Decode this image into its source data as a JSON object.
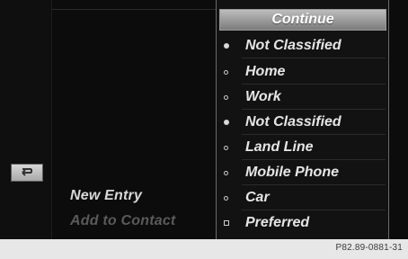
{
  "center": {
    "items": [
      {
        "label": "New Entry",
        "state": "active"
      },
      {
        "label": "Add to Contact",
        "state": "disabled"
      }
    ]
  },
  "panel": {
    "continue_label": "Continue",
    "rows": [
      {
        "label": "Not Classified",
        "marker": "dot-filled"
      },
      {
        "label": "Home",
        "marker": "dot-hollow"
      },
      {
        "label": "Work",
        "marker": "dot-hollow"
      },
      {
        "label": "Not Classified",
        "marker": "dot-filled"
      },
      {
        "label": "Land Line",
        "marker": "dot-hollow"
      },
      {
        "label": "Mobile Phone",
        "marker": "dot-hollow"
      },
      {
        "label": "Car",
        "marker": "dot-hollow"
      },
      {
        "label": "Preferred",
        "marker": "square-hollow"
      }
    ]
  },
  "caption": {
    "code": "P82.89-0881-31"
  },
  "icons": {
    "back": "back-arrow-icon"
  },
  "colors": {
    "screen_bg": "#0b0b0b",
    "button_top": "#bdbdbd",
    "button_bottom": "#7b7b7b",
    "text_active": "#e6e6e6",
    "text_disabled": "#5a5a5a"
  }
}
